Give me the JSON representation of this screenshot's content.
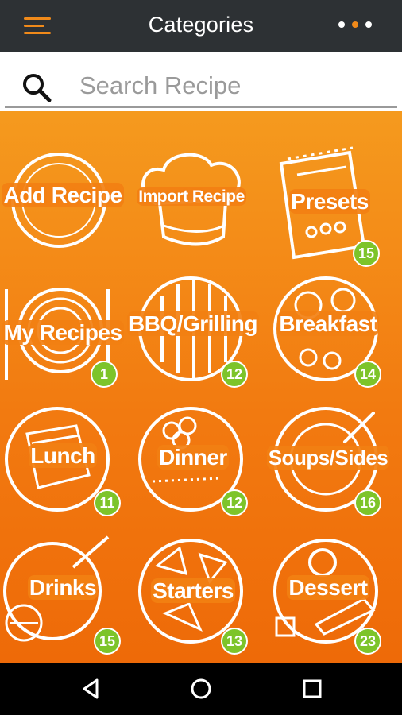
{
  "app_bar": {
    "title": "Categories",
    "menu_icon": "hamburger-menu-icon",
    "more_icon": "more-dots-icon",
    "accent_color": "#f08a1a",
    "background_color": "#2d3134"
  },
  "search": {
    "placeholder": "Search Recipe",
    "value": "",
    "icon": "search-icon"
  },
  "categories": [
    {
      "label": "Add Recipe",
      "badge": null,
      "icon": "plate-icon"
    },
    {
      "label": "Import Recipe",
      "badge": null,
      "icon": "chef-hat-icon"
    },
    {
      "label": "Presets",
      "badge": "15",
      "icon": "notepad-icon"
    },
    {
      "label": "My Recipes",
      "badge": "1",
      "icon": "place-setting-icon"
    },
    {
      "label": "BBQ/Grilling",
      "badge": "12",
      "icon": "grill-icon"
    },
    {
      "label": "Breakfast",
      "badge": "14",
      "icon": "breakfast-plate-icon"
    },
    {
      "label": "Lunch",
      "badge": "11",
      "icon": "sandwich-plate-icon"
    },
    {
      "label": "Dinner",
      "badge": "12",
      "icon": "dinner-plate-icon"
    },
    {
      "label": "Soups/Sides",
      "badge": "16",
      "icon": "soup-bowl-icon"
    },
    {
      "label": "Drinks",
      "badge": "15",
      "icon": "drink-glass-icon"
    },
    {
      "label": "Starters",
      "badge": "13",
      "icon": "starter-plate-icon"
    },
    {
      "label": "Dessert",
      "badge": "23",
      "icon": "dessert-plate-icon"
    }
  ],
  "colors": {
    "background_top": "#f59a1e",
    "background_bottom": "#ee6a08",
    "badge": "#7dc42a"
  },
  "system_nav": {
    "back_icon": "back-triangle-icon",
    "home_icon": "home-circle-icon",
    "recents_icon": "recents-square-icon"
  }
}
